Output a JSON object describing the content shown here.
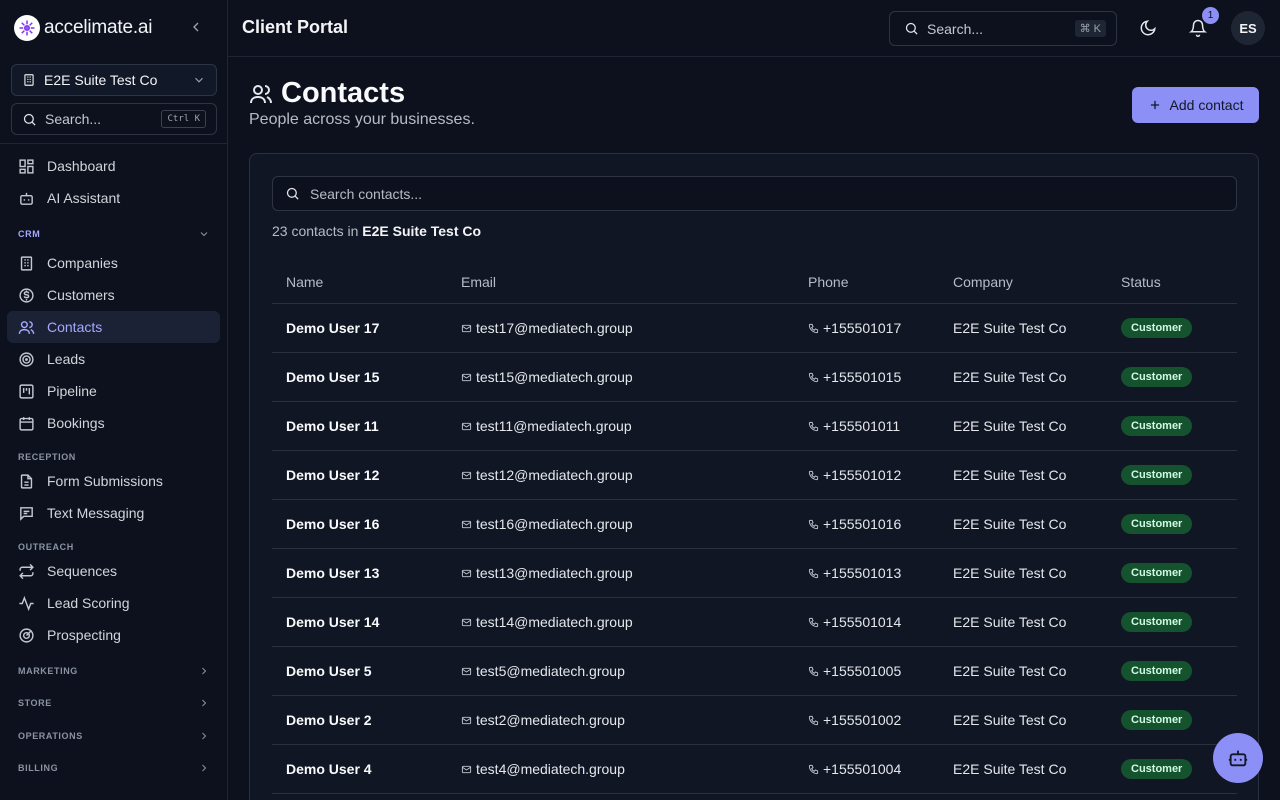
{
  "brand": {
    "name": "accelimate.ai"
  },
  "sidebar": {
    "company_selector": "E2E Suite Test Co",
    "search_placeholder": "Search...",
    "search_shortcut": "Ctrl K",
    "items": [
      {
        "label": "Dashboard",
        "icon": "dashboard-icon"
      },
      {
        "label": "AI Assistant",
        "icon": "bot-icon"
      },
      {
        "label": "Companies",
        "icon": "building-icon"
      },
      {
        "label": "Customers",
        "icon": "dollar-icon"
      },
      {
        "label": "Contacts",
        "icon": "users-icon",
        "active": true
      },
      {
        "label": "Leads",
        "icon": "target-icon"
      },
      {
        "label": "Pipeline",
        "icon": "kanban-icon"
      },
      {
        "label": "Bookings",
        "icon": "calendar-icon"
      },
      {
        "label": "Form Submissions",
        "icon": "file-icon"
      },
      {
        "label": "Text Messaging",
        "icon": "message-icon"
      },
      {
        "label": "Sequences",
        "icon": "repeat-icon"
      },
      {
        "label": "Lead Scoring",
        "icon": "activity-icon"
      },
      {
        "label": "Prospecting",
        "icon": "crosshair-icon"
      }
    ],
    "sections": {
      "crm": "CRM",
      "reception": "RECEPTION",
      "outreach": "OUTREACH",
      "marketing": "MARKETING",
      "store": "STORE",
      "operations": "OPERATIONS",
      "billing": "BILLING"
    }
  },
  "topbar": {
    "title": "Client Portal",
    "search_placeholder": "Search...",
    "search_shortcut": "⌘ K",
    "notification_count": "1",
    "avatar_initials": "ES"
  },
  "page": {
    "title": "Contacts",
    "subtitle": "People across your businesses.",
    "add_button": "Add contact",
    "search_placeholder": "Search contacts...",
    "count_text": "23 contacts in",
    "count_company": "E2E Suite Test Co"
  },
  "table": {
    "columns": [
      "Name",
      "Email",
      "Phone",
      "Company",
      "Status"
    ],
    "rows": [
      {
        "name": "Demo User 17",
        "email": "test17@mediatech.group",
        "phone": "+155501017",
        "company": "E2E Suite Test Co",
        "status": "Customer"
      },
      {
        "name": "Demo User 15",
        "email": "test15@mediatech.group",
        "phone": "+155501015",
        "company": "E2E Suite Test Co",
        "status": "Customer"
      },
      {
        "name": "Demo User 11",
        "email": "test11@mediatech.group",
        "phone": "+155501011",
        "company": "E2E Suite Test Co",
        "status": "Customer"
      },
      {
        "name": "Demo User 12",
        "email": "test12@mediatech.group",
        "phone": "+155501012",
        "company": "E2E Suite Test Co",
        "status": "Customer"
      },
      {
        "name": "Demo User 16",
        "email": "test16@mediatech.group",
        "phone": "+155501016",
        "company": "E2E Suite Test Co",
        "status": "Customer"
      },
      {
        "name": "Demo User 13",
        "email": "test13@mediatech.group",
        "phone": "+155501013",
        "company": "E2E Suite Test Co",
        "status": "Customer"
      },
      {
        "name": "Demo User 14",
        "email": "test14@mediatech.group",
        "phone": "+155501014",
        "company": "E2E Suite Test Co",
        "status": "Customer"
      },
      {
        "name": "Demo User 5",
        "email": "test5@mediatech.group",
        "phone": "+155501005",
        "company": "E2E Suite Test Co",
        "status": "Customer"
      },
      {
        "name": "Demo User 2",
        "email": "test2@mediatech.group",
        "phone": "+155501002",
        "company": "E2E Suite Test Co",
        "status": "Customer"
      },
      {
        "name": "Demo User 4",
        "email": "test4@mediatech.group",
        "phone": "+155501004",
        "company": "E2E Suite Test Co",
        "status": "Customer"
      }
    ]
  },
  "colors": {
    "background": "#0c111d",
    "accent": "#8b8ff6",
    "active_nav": "#a5a8ff",
    "badge_bg": "#14532d"
  }
}
